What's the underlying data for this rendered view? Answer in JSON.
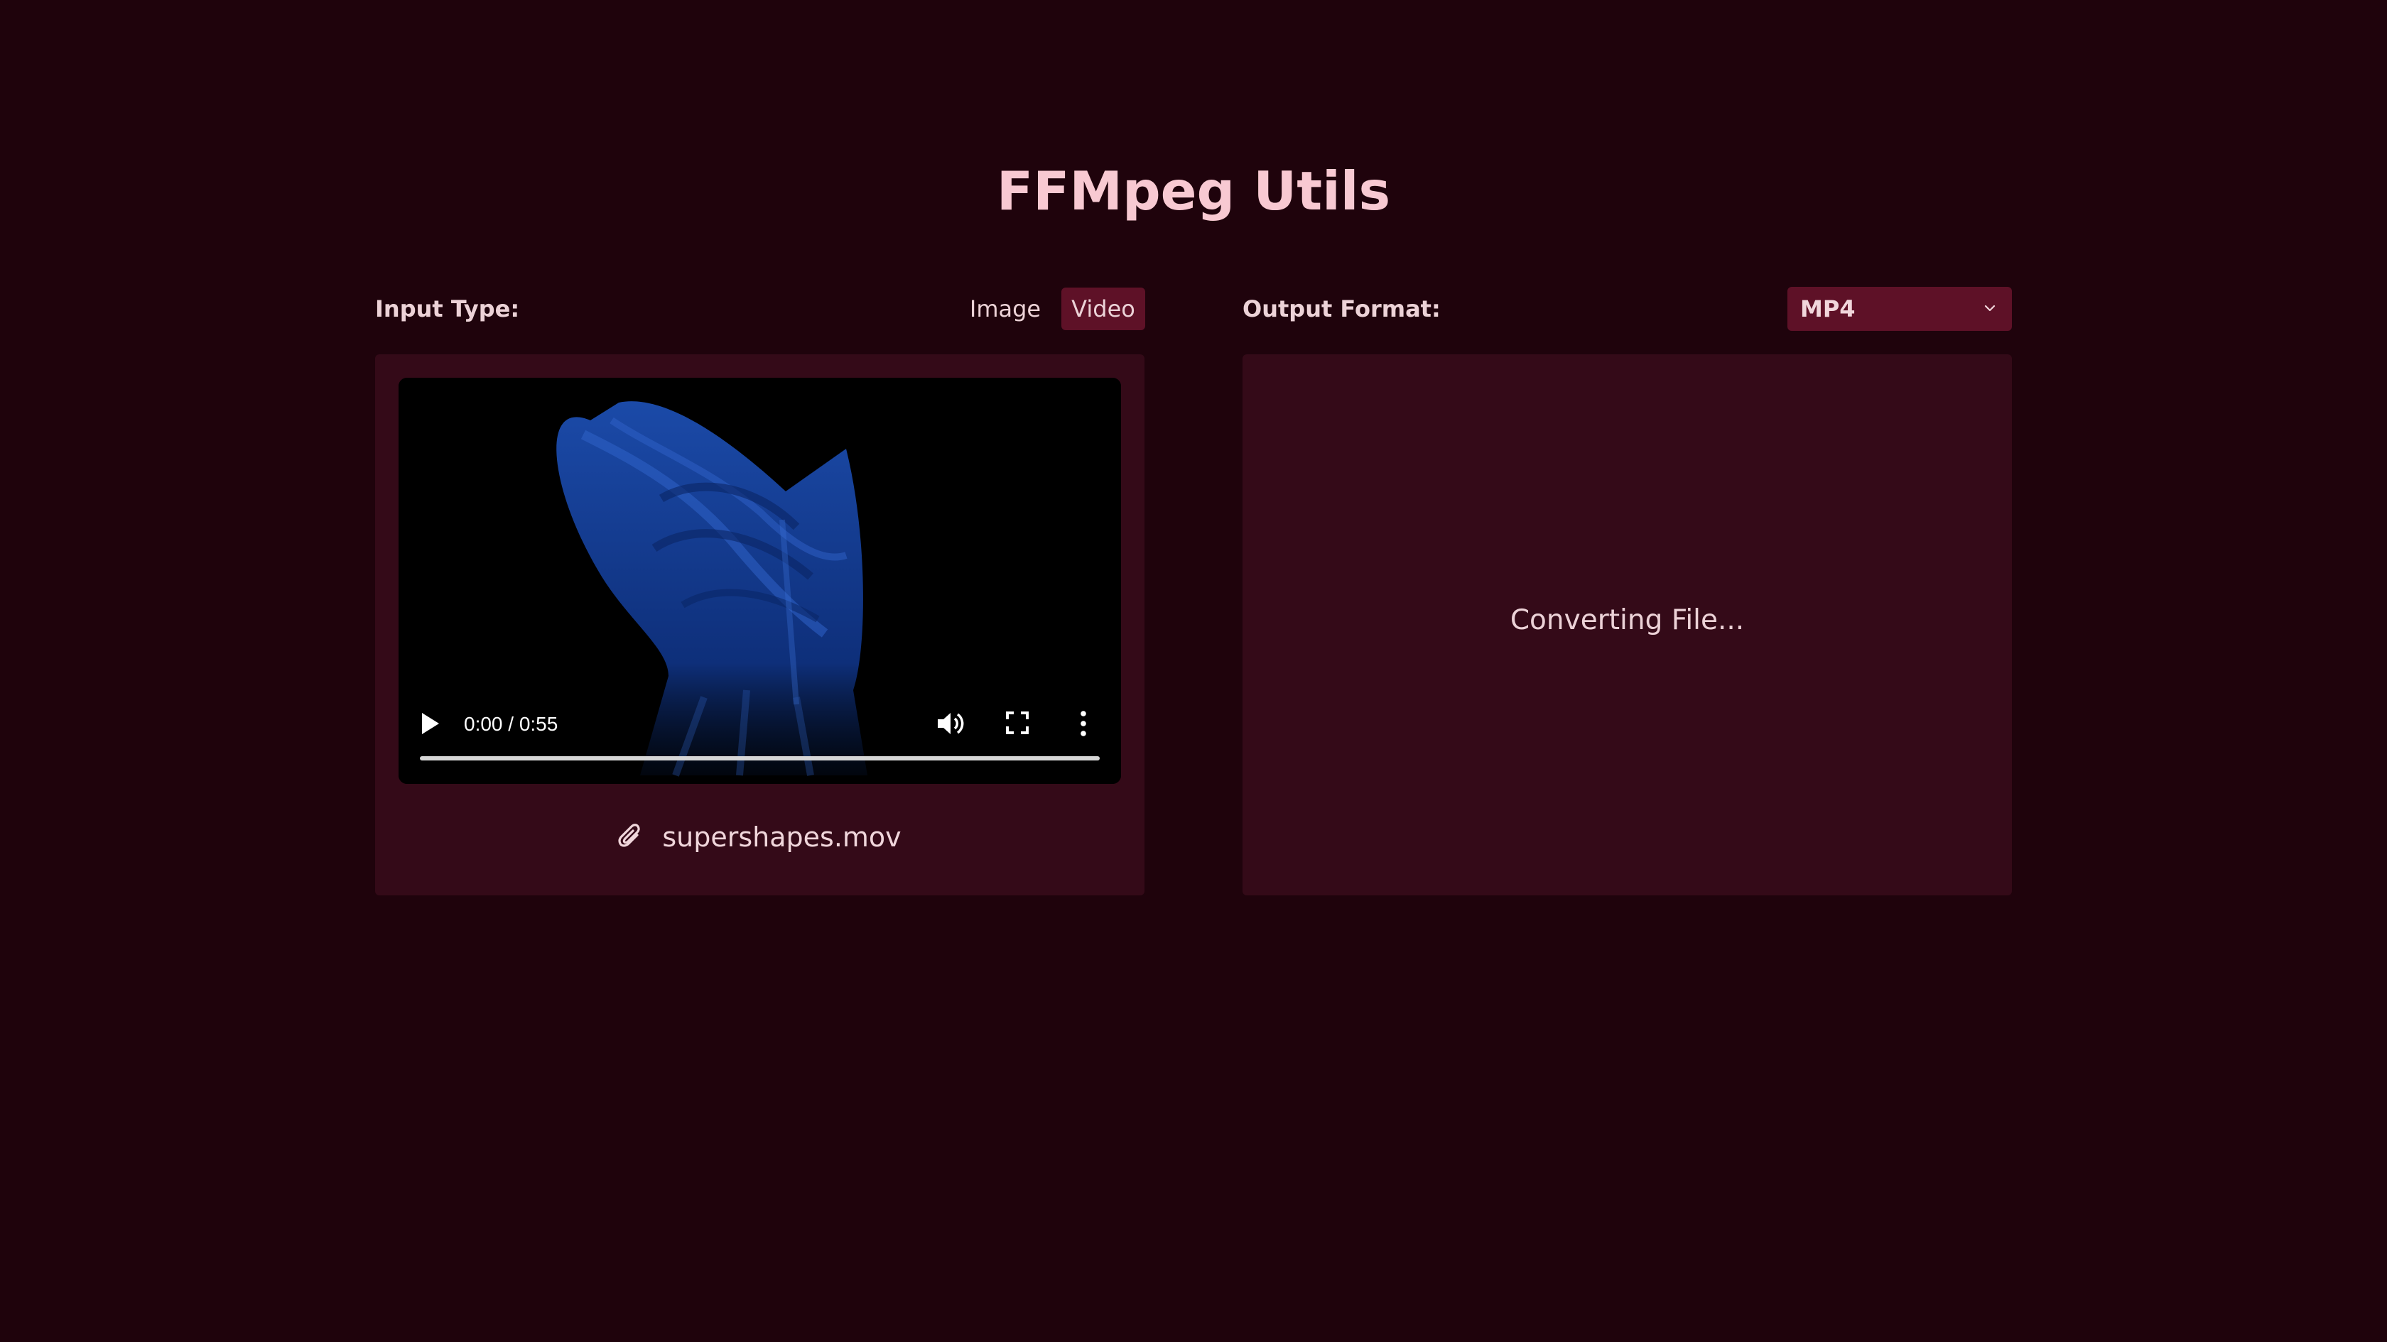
{
  "app": {
    "title": "FFMpeg Utils"
  },
  "input": {
    "label": "Input Type:",
    "options": [
      "Image",
      "Video"
    ],
    "selected": "Video",
    "file_name": "supershapes.mov"
  },
  "video_player": {
    "time_display": "0:00 / 0:55",
    "progress": 0
  },
  "output": {
    "label": "Output Format:",
    "format": "MP4",
    "status": "Converting File..."
  },
  "colors": {
    "background": "#1f030c",
    "panel": "#340a18",
    "accent": "#5e1127",
    "title": "#f8c9d2"
  }
}
